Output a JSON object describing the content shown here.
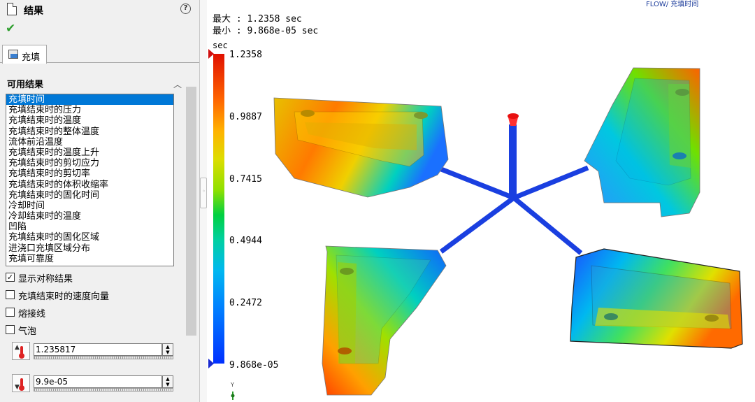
{
  "panel": {
    "title": "结果",
    "help_icon": "?",
    "ok_icon": "✔",
    "tab_label": "充填",
    "section_title": "可用结果",
    "results": [
      "充填时间",
      "充填结束时的压力",
      "充填结束时的温度",
      "充填结束时的整体温度",
      "流体前沿温度",
      "充填结束时的温度上升",
      "充填结束时的剪切应力",
      "充填结束时的剪切率",
      "充填结束时的体积收缩率",
      "充填结束时的固化时间",
      "冷却时间",
      "冷却结束时的温度",
      "凹陷",
      "充填结束时的固化区域",
      "进浇口充填区域分布",
      "充填可靠度"
    ],
    "selected_result": "充填时间",
    "checkboxes": [
      {
        "label": "显示对称结果",
        "checked": true
      },
      {
        "label": "充填结束时的速度向量",
        "checked": false
      },
      {
        "label": "熔接线",
        "checked": false
      },
      {
        "label": "气泡",
        "checked": false
      }
    ],
    "max_value": "1.235817",
    "min_value": "9.9e-05"
  },
  "viewport": {
    "brand": "FLOW/ 充填时间",
    "max_line": "最大 : 1.2358 sec",
    "min_line": "最小 : 9.868e-05 sec",
    "unit": "sec",
    "ticks": [
      "1.2358",
      "0.9887",
      "0.7415",
      "0.4944",
      "0.2472",
      "9.868e-05"
    ],
    "axis_label": "Y"
  },
  "colors": {
    "accent": "#0078d7",
    "scale_high": "#e01000",
    "scale_low": "#0030ff"
  }
}
